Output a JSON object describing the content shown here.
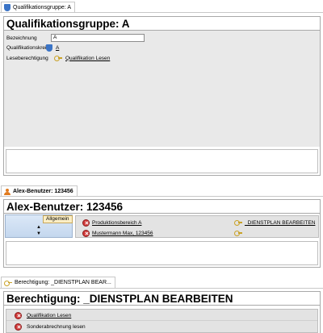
{
  "section1": {
    "tab_label": "Qualifikationsgruppe: A",
    "title": "Qualifikationsgruppe: A",
    "fields": {
      "bezeichnung_label": "Bezeichnung",
      "bezeichnung_value": "A",
      "kreis_label": "Qualifikationskreis",
      "kreis_value": "A",
      "lese_label": "Leseberechtigung",
      "lese_value": "Qualifikation Lesen"
    }
  },
  "section2": {
    "tab_label": "Alex-Benutzer: 123456",
    "title": "Alex-Benutzer: 123456",
    "nav_tab": "Allgemein",
    "rows": [
      {
        "name": "Produktionsbereich A",
        "permission": "_DIENSTPLAN BEARBEITEN"
      },
      {
        "name": "Mustermann Max, 123456",
        "permission": ""
      }
    ]
  },
  "section3": {
    "tab_label": "Berechtigung: _DIENSTPLAN BEAR...",
    "title": "Berechtigung: _DIENSTPLAN BEARBEITEN",
    "items": [
      {
        "label": "Qualifikation Lesen"
      },
      {
        "label": "Sonderabrechnung lesen"
      }
    ]
  },
  "icons": {
    "qualification_tab": "shield-icon",
    "user_tab": "user-icon",
    "permission_tab": "key-icon",
    "remove": "red-x-icon"
  },
  "colors": {
    "form_background": "#e9e9e9",
    "nav_gradient_top": "#dbe8f7",
    "nav_gradient_bottom": "#c4d7ee",
    "nav_tab_active": "#fbeec4",
    "remove_red": "#d13a3a",
    "key_gold": "#c9a227"
  }
}
